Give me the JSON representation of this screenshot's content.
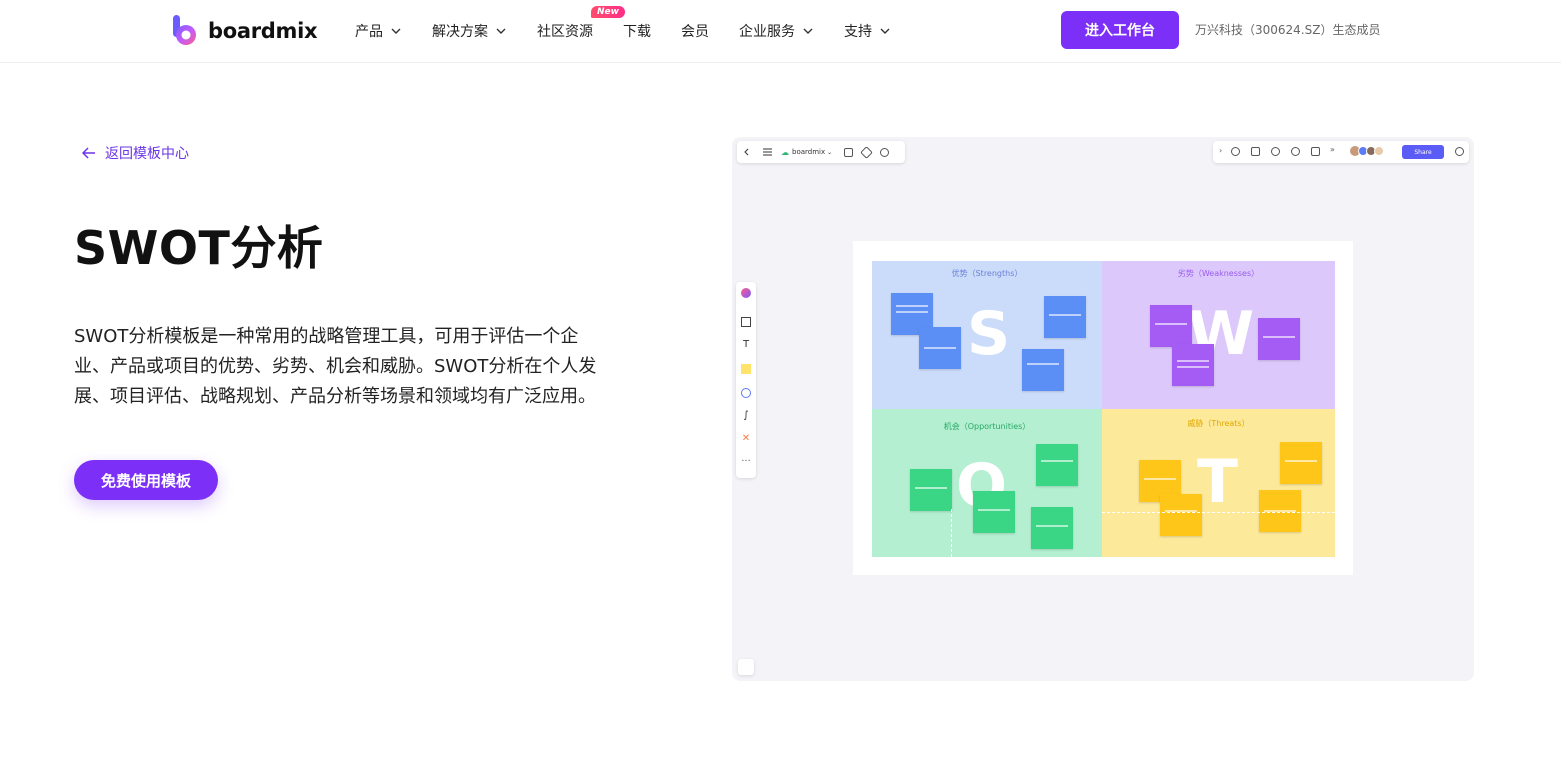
{
  "brand": {
    "name": "boardmix"
  },
  "nav": {
    "items": [
      {
        "label": "产品",
        "has_dropdown": true
      },
      {
        "label": "解决方案",
        "has_dropdown": true
      },
      {
        "label": "社区资源",
        "has_dropdown": false,
        "badge": "New"
      },
      {
        "label": "下载",
        "has_dropdown": false
      },
      {
        "label": "会员",
        "has_dropdown": false
      },
      {
        "label": "企业服务",
        "has_dropdown": true
      },
      {
        "label": "支持",
        "has_dropdown": true
      }
    ],
    "cta": "进入工作台",
    "ecosystem": "万兴科技（300624.SZ）生态成员"
  },
  "hero": {
    "back_link": "返回模板中心",
    "title": "SWOT分析",
    "description": "SWOT分析模板是一种常用的战略管理工具，可用于评估一个企业、产品或项目的优势、劣势、机会和威胁。SWOT分析在个人发展、项目评估、战略规划、产品分析等场景和领域均有广泛应用。",
    "cta": "免费使用模板"
  },
  "preview": {
    "toolbar": {
      "workspace": "boardmix",
      "share": "Share"
    },
    "quadrants": {
      "s": {
        "label": "优势（Strengths）",
        "letter": "S"
      },
      "w": {
        "label": "劣势（Weaknesses）",
        "letter": "W"
      },
      "o": {
        "label": "机会（Opportunities）",
        "letter": "O"
      },
      "t": {
        "label": "威胁（Threats）",
        "letter": "T"
      }
    }
  },
  "colors": {
    "accent": "#7b2ff7",
    "strengths_bg": "#cbdcfb",
    "weaknesses_bg": "#dcc8fb",
    "opportunities_bg": "#b3efd0",
    "threats_bg": "#fde99a"
  }
}
